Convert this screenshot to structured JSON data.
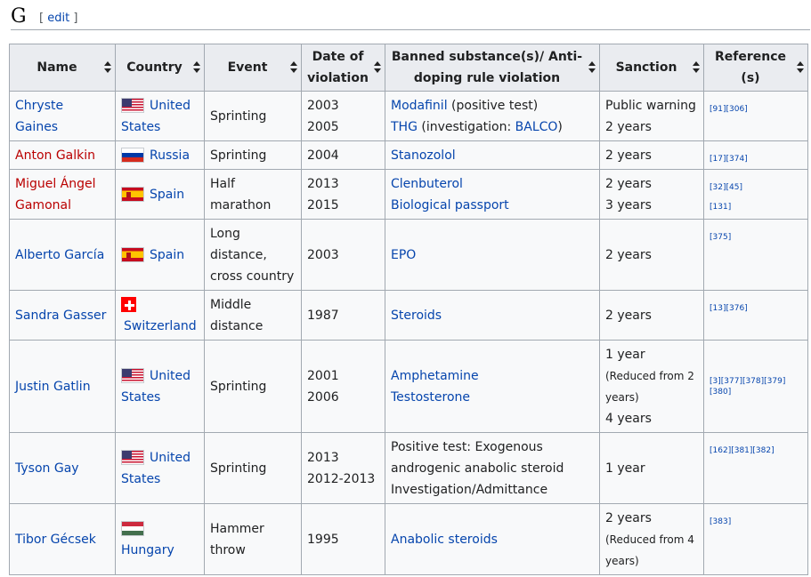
{
  "section": {
    "title": "G",
    "edit_open": "[",
    "edit_label": "edit",
    "edit_close": "]"
  },
  "columns": [
    "Name",
    "Country",
    "Event",
    "Date of violation",
    "Banned substance(s)/ Anti-doping rule violation",
    "Sanction",
    "Reference (s)"
  ],
  "rows": [
    {
      "name": "Chryste Gaines",
      "name_link": "blue",
      "country": "United States",
      "country_lines": [
        "United",
        "States"
      ],
      "flag": "us",
      "event_lines": [
        "Sprinting"
      ],
      "date_lines": [
        "2003",
        "2005"
      ],
      "substance_lines": [
        {
          "parts": [
            {
              "text": "Modafinil",
              "link": true
            },
            {
              "text": " (positive test)",
              "link": false
            }
          ]
        },
        {
          "parts": [
            {
              "text": "THG",
              "link": true
            },
            {
              "text": " (investigation: ",
              "link": false
            },
            {
              "text": "BALCO",
              "link": true
            },
            {
              "text": ")",
              "link": false
            }
          ]
        }
      ],
      "sanction_lines": [
        "Public warning",
        "2 years"
      ],
      "refs": [
        "[91][306]"
      ]
    },
    {
      "name": "Anton Galkin",
      "name_link": "red",
      "country": "Russia",
      "country_lines": [
        "Russia"
      ],
      "flag": "ru",
      "event_lines": [
        "Sprinting"
      ],
      "date_lines": [
        "2004"
      ],
      "substance_lines": [
        {
          "parts": [
            {
              "text": "Stanozolol",
              "link": true
            }
          ]
        }
      ],
      "sanction_lines": [
        "2 years"
      ],
      "refs": [
        "[17][374]"
      ]
    },
    {
      "name": "Miguel Ángel Gamonal",
      "name_link": "red",
      "name_lines": [
        "Miguel Ángel",
        "Gamonal"
      ],
      "country": "Spain",
      "country_lines": [
        "Spain"
      ],
      "flag": "es",
      "event_lines": [
        "Half marathon"
      ],
      "date_lines": [
        "2013",
        "2015"
      ],
      "substance_lines": [
        {
          "parts": [
            {
              "text": "Clenbuterol",
              "link": true
            }
          ]
        },
        {
          "parts": [
            {
              "text": "Biological passport",
              "link": true
            }
          ]
        }
      ],
      "sanction_lines": [
        "2 years",
        "3 years"
      ],
      "refs": [
        "[32][45]",
        "[131]"
      ]
    },
    {
      "name": "Alberto García",
      "name_link": "blue",
      "country": "Spain",
      "country_lines": [
        "Spain"
      ],
      "flag": "es",
      "event_lines": [
        "Long",
        "distance,",
        "cross country"
      ],
      "date_lines": [
        "2003"
      ],
      "substance_lines": [
        {
          "parts": [
            {
              "text": "EPO",
              "link": true
            }
          ]
        }
      ],
      "sanction_lines": [
        "2 years"
      ],
      "refs": [
        "[375]"
      ]
    },
    {
      "name": "Sandra Gasser",
      "name_link": "blue",
      "country": "Switzerland",
      "country_lines": [
        "Switzerland"
      ],
      "flag": "ch",
      "event_lines": [
        "Middle",
        "distance"
      ],
      "date_lines": [
        "1987"
      ],
      "substance_lines": [
        {
          "parts": [
            {
              "text": "Steroids",
              "link": true
            }
          ]
        }
      ],
      "sanction_lines": [
        "2 years"
      ],
      "refs": [
        "[13][376]"
      ]
    },
    {
      "name": "Justin Gatlin",
      "name_link": "blue",
      "country": "United States",
      "country_lines": [
        "United",
        "States"
      ],
      "flag": "us",
      "event_lines": [
        "Sprinting"
      ],
      "date_lines": [
        "2001",
        "2006"
      ],
      "substance_lines": [
        {
          "parts": [
            {
              "text": "Amphetamine",
              "link": true
            }
          ]
        },
        {
          "parts": [
            {
              "text": "Testosterone",
              "link": true
            }
          ]
        }
      ],
      "sanction_lines": [
        "1 year",
        "(Reduced from 2",
        "years)",
        "4 years"
      ],
      "refs": [
        "[3][377][378][379][380]"
      ]
    },
    {
      "name": "Tyson Gay",
      "name_link": "blue",
      "country": "United States",
      "country_lines": [
        "United",
        "States"
      ],
      "flag": "us",
      "event_lines": [
        "Sprinting"
      ],
      "date_lines": [
        "2013",
        "2012-2013"
      ],
      "substance_lines": [
        {
          "parts": [
            {
              "text": "Positive test: Exogenous",
              "link": false
            }
          ]
        },
        {
          "parts": [
            {
              "text": "androgenic anabolic steroid",
              "link": false
            }
          ]
        },
        {
          "parts": [
            {
              "text": "Investigation/Admittance",
              "link": false
            }
          ]
        }
      ],
      "sanction_lines": [
        "1 year"
      ],
      "refs": [
        "[162][381][382]"
      ]
    },
    {
      "name": "Tibor Gécsek",
      "name_link": "blue",
      "country": "Hungary",
      "country_lines": [
        "Hungary"
      ],
      "flag": "hu",
      "event_lines": [
        "Hammer",
        "throw"
      ],
      "date_lines": [
        "1995"
      ],
      "substance_lines": [
        {
          "parts": [
            {
              "text": "Anabolic steroids",
              "link": true
            }
          ]
        }
      ],
      "sanction_lines": [
        "2 years",
        "(Reduced from 4",
        "years)"
      ],
      "refs": [
        "[383]"
      ]
    }
  ]
}
